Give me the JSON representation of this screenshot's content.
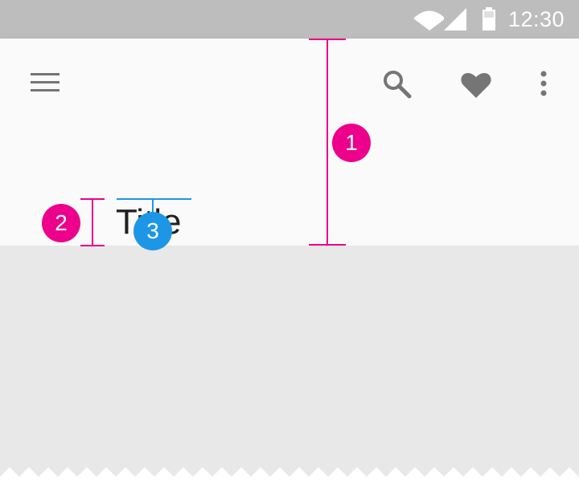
{
  "status_bar": {
    "time": "12:30",
    "icons": [
      "wifi-icon",
      "cell-signal-icon",
      "battery-icon"
    ]
  },
  "app_bar": {
    "title": "Title",
    "navigation_icon": "menu-icon",
    "action_icons": [
      "search-icon",
      "heart-icon",
      "more-vert-icon"
    ]
  },
  "annotations": [
    {
      "label": "1",
      "color": "#ec008c"
    },
    {
      "label": "2",
      "color": "#ec008c"
    },
    {
      "label": "3",
      "color": "#1e96e6"
    }
  ],
  "colors": {
    "status_bar": "#bdbdbd",
    "app_bar": "#fafafa",
    "icon": "#757575",
    "content": "#e8e8e8",
    "accent_pink": "#ec008c",
    "accent_blue": "#1e96e6"
  }
}
